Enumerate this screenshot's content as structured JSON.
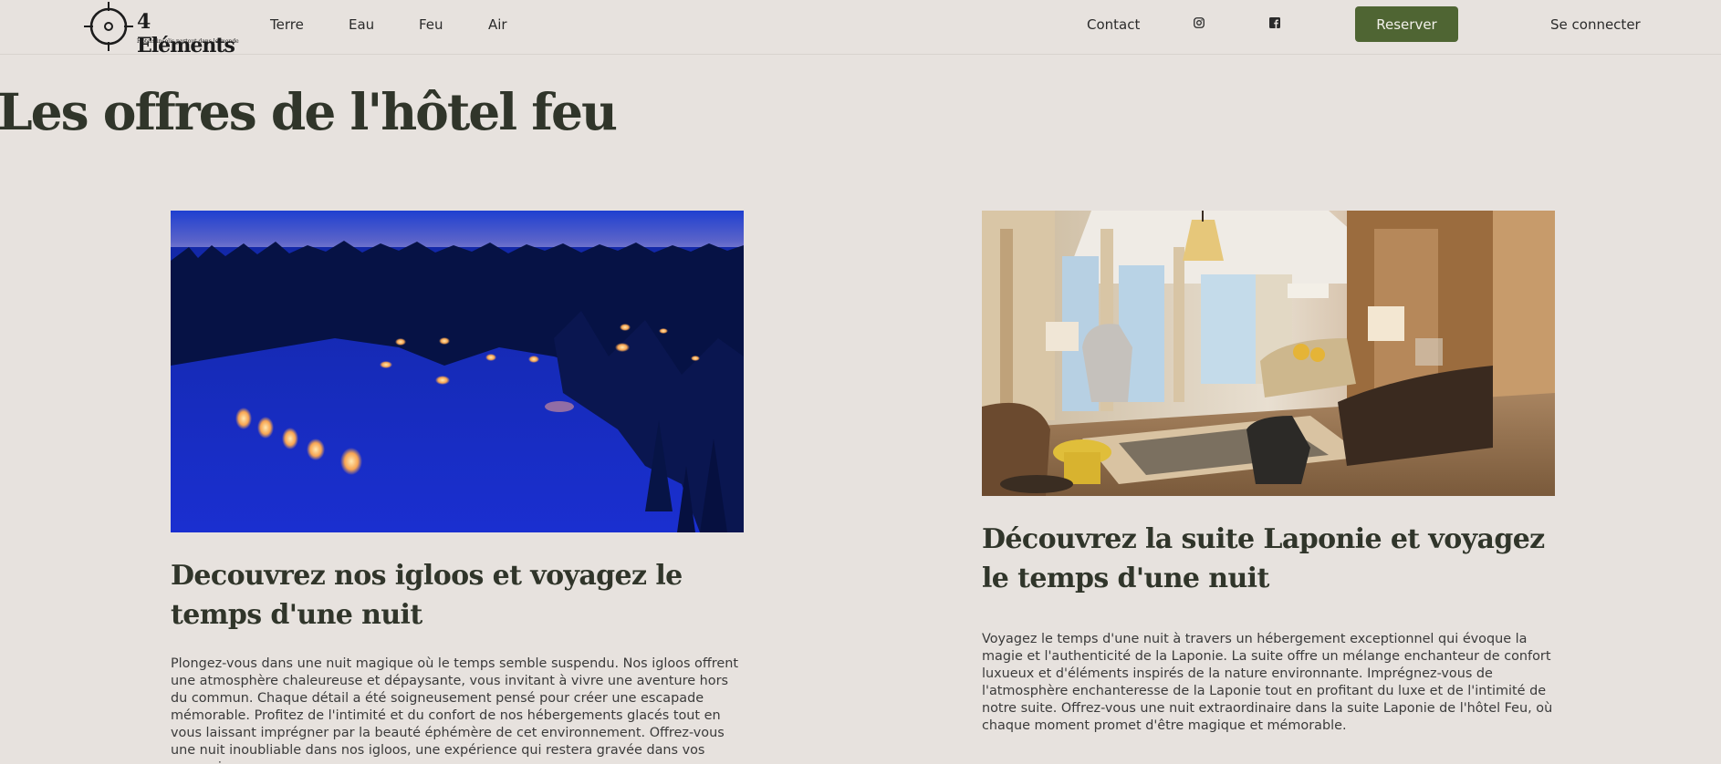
{
  "brand": {
    "name": "4 Eléments",
    "tagline": "Hôtels insolis partout dans le monde"
  },
  "nav": {
    "links": [
      "Terre",
      "Eau",
      "Feu",
      "Air"
    ],
    "contact": "Contact",
    "reserve": "Reserver",
    "login": "Se connecter",
    "icons": [
      "instagram-icon",
      "facebook-icon"
    ]
  },
  "page": {
    "title": "Les offres de l'hôtel feu"
  },
  "offers": [
    {
      "title": "Decouvrez nos igloos et voyagez le temps d'une nuit",
      "description": "Plongez-vous dans une nuit magique où le temps semble suspendu. Nos igloos offrent une atmosphère chaleureuse et dépaysante, vous invitant à vivre une aventure hors du commun. Chaque détail a été soigneusement pensé pour créer une escapade mémorable. Profitez de l'intimité et du confort de nos hébergements glacés tout en vous laissant imprégner par la beauté éphémère de cet environnement. Offrez-vous une nuit inoubliable dans nos igloos, une expérience qui restera gravée dans vos souvenirs."
    },
    {
      "title": "Découvrez la suite Laponie et voyagez le temps d'une nuit",
      "description": "Voyagez le temps d'une nuit à travers un hébergement exceptionnel qui évoque la magie et l'authenticité de la Laponie. La suite offre un mélange enchanteur de confort luxueux et d'éléments inspirés de la nature environnante. Imprégnez-vous de l'atmosphère enchanteresse de la Laponie tout en profitant du luxe et de l'intimité de notre suite. Offrez-vous une nuit extraordinaire dans la suite Laponie de l'hôtel Feu, où chaque moment promet d'être magique et mémorable."
    }
  ],
  "colors": {
    "background": "#e7e2de",
    "accent": "#4f6533",
    "heading": "#30352a"
  }
}
